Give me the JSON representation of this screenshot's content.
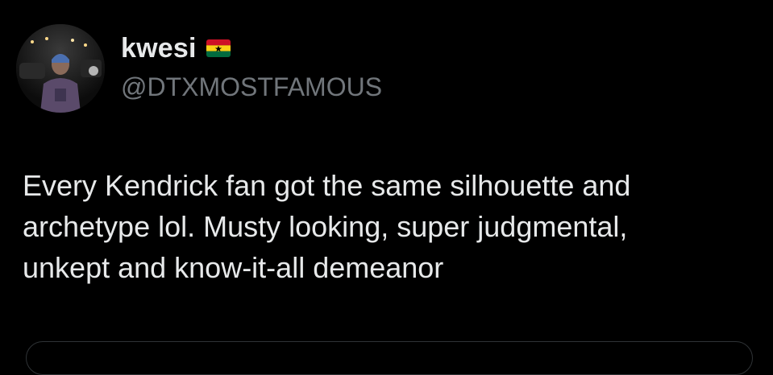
{
  "tweet": {
    "author": {
      "display_name": "kwesi",
      "flag": "ghana-flag-icon",
      "handle": "@DTXMOSTFAMOUS",
      "avatar": "profile-photo"
    },
    "text": "Every Kendrick fan got the same silhouette and\narchetype lol. Musty looking, super judgmental,\nunkept and know-it-all demeanor"
  },
  "colors": {
    "background": "#000000",
    "text_primary": "#e7e9ea",
    "text_secondary": "#71767b",
    "border": "#2f3336"
  }
}
